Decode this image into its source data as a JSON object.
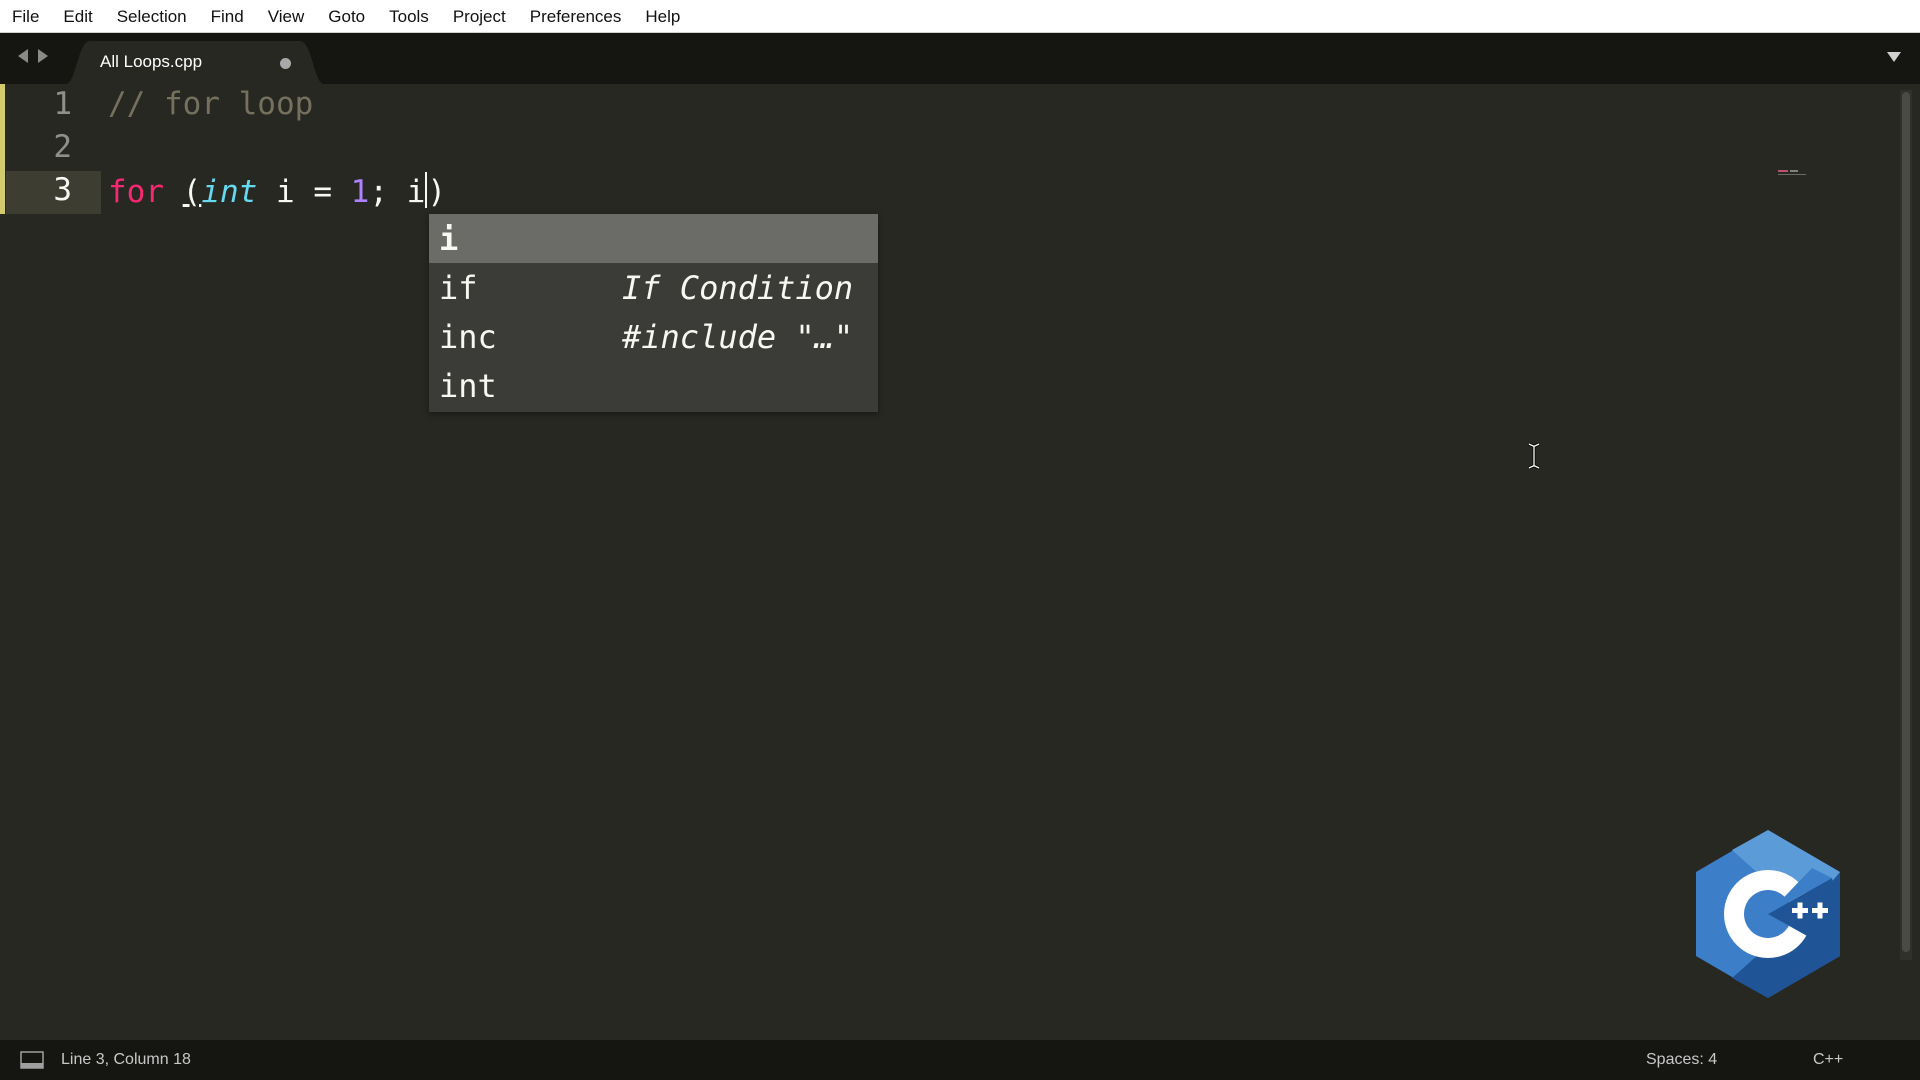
{
  "menu": [
    "File",
    "Edit",
    "Selection",
    "Find",
    "View",
    "Goto",
    "Tools",
    "Project",
    "Preferences",
    "Help"
  ],
  "tab": {
    "title": "All Loops.cpp",
    "dirty": true
  },
  "editor": {
    "line_numbers": [
      "1",
      "2",
      "3"
    ],
    "line1": {
      "comment": "// for loop"
    },
    "line3": {
      "kw": "for",
      "paren_open": "(",
      "type": "int",
      "var_decl": " i = ",
      "num": "1",
      "rest": "; i",
      "paren_close": ")"
    }
  },
  "autocomplete": {
    "items": [
      {
        "trigger": "i",
        "annotation": "",
        "selected": true
      },
      {
        "trigger": "if",
        "annotation": "If Condition",
        "selected": false
      },
      {
        "trigger": "inc",
        "annotation": "#include \"…\"",
        "selected": false
      },
      {
        "trigger": "int",
        "annotation": "",
        "selected": false
      }
    ]
  },
  "status": {
    "position": "Line 3, Column 18",
    "indent": "Spaces: 4",
    "syntax": "C++"
  },
  "colors": {
    "background": "#272822",
    "keyword": "#f92672",
    "type": "#66d9ef",
    "number": "#ae81ff",
    "comment": "#75715e",
    "logo_blue": "#3c7fc8",
    "logo_dark_blue": "#1f5497"
  }
}
